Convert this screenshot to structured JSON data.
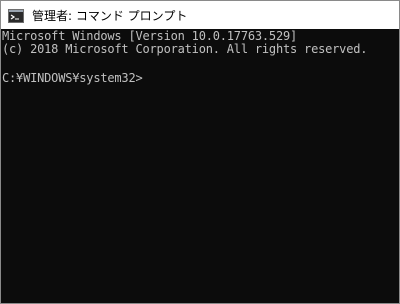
{
  "window": {
    "title": "管理者: コマンド プロンプト",
    "icon": "console-app-icon"
  },
  "console": {
    "lines": [
      "Microsoft Windows [Version 10.0.17763.529]",
      "(c) 2018 Microsoft Corporation. All rights reserved.",
      "",
      "C:¥WINDOWS¥system32>"
    ],
    "text_color": "#c0c0c0",
    "background_color": "#0c0c0c"
  }
}
